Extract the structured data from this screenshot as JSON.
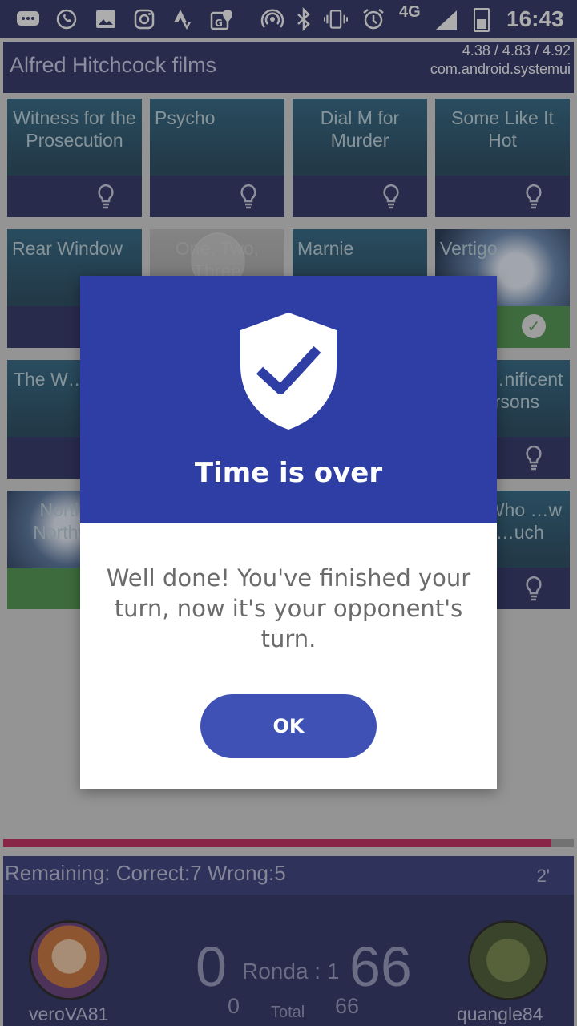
{
  "status_bar": {
    "icons": [
      "messages-icon",
      "whatsapp-icon",
      "gallery-icon",
      "instagram-icon",
      "strava-icon",
      "maps-icon",
      "hotspot-icon",
      "bluetooth-icon",
      "vibrate-icon",
      "alarm-icon"
    ],
    "network": "4G",
    "time": "16:43"
  },
  "header": {
    "title": "Alfred Hitchcock films",
    "overlay_line1": "4.38 / 4.83 / 4.92",
    "overlay_line2": "com.android.systemui"
  },
  "tiles": [
    {
      "title": "Witness for the Prosecution",
      "status": "hint"
    },
    {
      "title": "Psycho",
      "status": "hint"
    },
    {
      "title": "Dial M for Murder",
      "status": "hint"
    },
    {
      "title": "Some Like It Hot",
      "status": "hint"
    },
    {
      "title": "Rear Window",
      "status": "hint"
    },
    {
      "title": "One, Two, Three",
      "status": "image"
    },
    {
      "title": "Marnie",
      "status": "hint"
    },
    {
      "title": "Vertigo",
      "status": "correct"
    },
    {
      "title": "The W… Ma…",
      "status": "hint"
    },
    {
      "title": "…he …nificent …ersons",
      "status": "hint"
    },
    {
      "title": "North by Northwest",
      "status": "correct"
    },
    {
      "title": "…an Who …w Too …uch",
      "status": "hint"
    }
  ],
  "dialog": {
    "title": "Time is over",
    "message": "Well done! You've finished your turn, now it's your opponent's turn.",
    "ok_label": "OK",
    "icon": "shield-check-icon"
  },
  "progress": {
    "fraction": 0.96,
    "color": "#c1154f"
  },
  "score": {
    "remaining_text": "Remaining:  Correct:7  Wrong:5",
    "timer": "2'",
    "player1": {
      "name": "veroVA81",
      "score": "0",
      "total": "0"
    },
    "player2": {
      "name": "quangle84",
      "score": "66",
      "total": "66"
    },
    "round_label": "Ronda : 1",
    "total_label": "Total"
  },
  "colors": {
    "primary": "#2f3ea4",
    "button": "#3f51b5",
    "dark": "#1b1f58",
    "correct": "#3e8e3e"
  }
}
